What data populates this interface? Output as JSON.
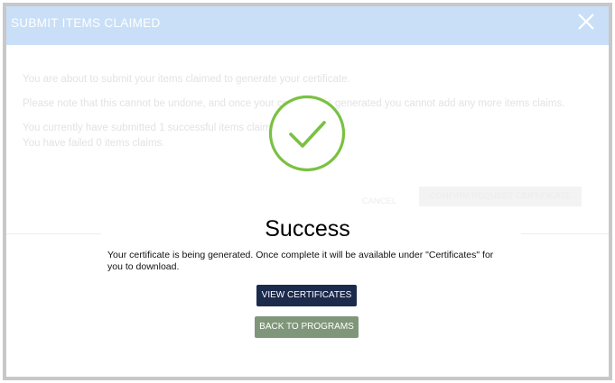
{
  "modal": {
    "title": "SUBMIT ITEMS CLAIMED",
    "line1": "You are about to submit your items claimed to generate your certificate.",
    "line2": "Please note that this cannot be undone, and once your certificate is generated you cannot add any more items claims.",
    "line3": "You currently have submitted 1 successful items claims for processing.",
    "line4": "You have failed 0 items claims.",
    "cancel_label": "CANCEL",
    "confirm_label": "CONFIRM REQUEST CERTIFICATE"
  },
  "success": {
    "title": "Success",
    "message": "Your certificate is being generated. Once complete it will be available under \"Certificates\" for you to download.",
    "view_certificates_label": "VIEW CERTIFICATES",
    "back_to_programs_label": "BACK TO PROGRAMS"
  },
  "colors": {
    "header_bg": "#c9dff7",
    "check_green": "#7ac142",
    "primary_button": "#1c2a4c",
    "secondary_button": "#80967a"
  },
  "icons": {
    "close": "close-icon",
    "success": "checkmark-circle-icon"
  }
}
